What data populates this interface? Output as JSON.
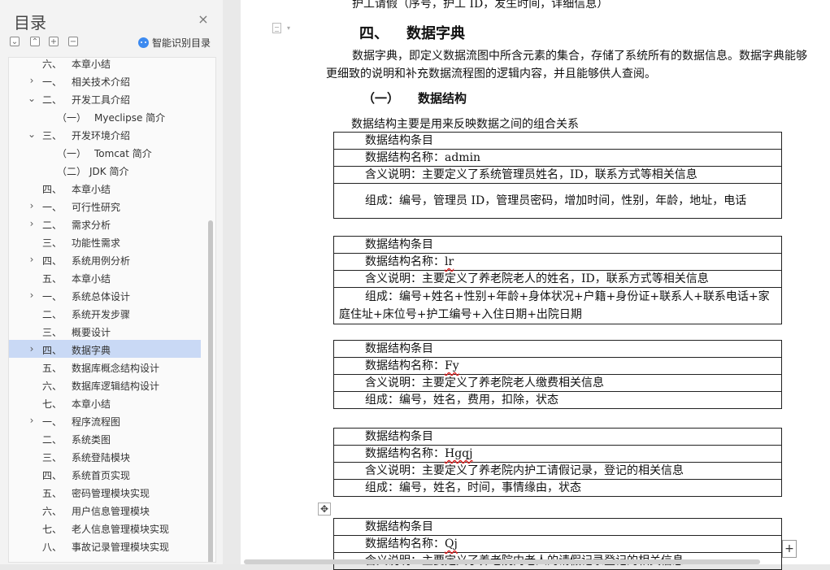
{
  "sidebar": {
    "title": "目录",
    "close": "×",
    "toolbar": {
      "collapse_all": "⌄",
      "expand_all": "⌃",
      "add": "+",
      "remove": "−",
      "ai_toc": "智能识别目录"
    },
    "items": [
      {
        "num": "六、",
        "label": "本章小结",
        "level": 1,
        "arrow": ""
      },
      {
        "num": "一、",
        "label": "相关技术介绍",
        "level": 1,
        "arrow": "›"
      },
      {
        "num": "二、",
        "label": "开发工具介绍",
        "level": 1,
        "arrow": "⌄"
      },
      {
        "num": "（一）",
        "label": "Myeclipse 简介",
        "level": 2,
        "arrow": ""
      },
      {
        "num": "三、",
        "label": "开发环境介绍",
        "level": 1,
        "arrow": "⌄"
      },
      {
        "num": "（一）",
        "label": "Tomcat 简介",
        "level": 2,
        "arrow": ""
      },
      {
        "num": "（二）",
        "label": "JDK 简介",
        "level": 2,
        "arrow": ""
      },
      {
        "num": "四、",
        "label": "本章小结",
        "level": 1,
        "arrow": ""
      },
      {
        "num": "一、",
        "label": "可行性研究",
        "level": 1,
        "arrow": "›"
      },
      {
        "num": "二、",
        "label": "需求分析",
        "level": 1,
        "arrow": "›"
      },
      {
        "num": "三、",
        "label": "功能性需求",
        "level": 1,
        "arrow": ""
      },
      {
        "num": "四、",
        "label": "系统用例分析",
        "level": 1,
        "arrow": "›"
      },
      {
        "num": "五、",
        "label": "本章小结",
        "level": 1,
        "arrow": ""
      },
      {
        "num": "一、",
        "label": "系统总体设计",
        "level": 1,
        "arrow": "›"
      },
      {
        "num": "二、",
        "label": "系统开发步骤",
        "level": 1,
        "arrow": ""
      },
      {
        "num": "三、",
        "label": "概要设计",
        "level": 1,
        "arrow": ""
      },
      {
        "num": "四、",
        "label": "数据字典",
        "level": 1,
        "arrow": "›",
        "selected": true
      },
      {
        "num": "五、",
        "label": "数据库概念结构设计",
        "level": 1,
        "arrow": ""
      },
      {
        "num": "六、",
        "label": "数据库逻辑结构设计",
        "level": 1,
        "arrow": ""
      },
      {
        "num": "七、",
        "label": "本章小结",
        "level": 1,
        "arrow": ""
      },
      {
        "num": "一、",
        "label": "程序流程图",
        "level": 1,
        "arrow": "›"
      },
      {
        "num": "二、",
        "label": "系统类图",
        "level": 1,
        "arrow": ""
      },
      {
        "num": "三、",
        "label": "系统登陆模块",
        "level": 1,
        "arrow": ""
      },
      {
        "num": "四、",
        "label": "系统首页实现",
        "level": 1,
        "arrow": ""
      },
      {
        "num": "五、",
        "label": "密码管理模块实现",
        "level": 1,
        "arrow": ""
      },
      {
        "num": "六、",
        "label": "用户信息管理模块",
        "level": 1,
        "arrow": ""
      },
      {
        "num": "七、",
        "label": "老人信息管理模块实现",
        "level": 1,
        "arrow": ""
      },
      {
        "num": "八、",
        "label": "事故记录管理模块实现",
        "level": 1,
        "arrow": ""
      }
    ]
  },
  "document": {
    "top_cut": "护工请假（序号，护工 ID，发生时间，详细信息）",
    "heading_num": "四、",
    "heading": "数据字典",
    "para1": "数据字典，即定义数据流图中所含元素的集合，存储了系统所有的数据信息。数据字典能够更细致的说明和补充数据流程图的逻辑内容，并且能够供人查阅。",
    "subheading_num": "（一）",
    "subheading": "数据结构",
    "para2": "数据结构主要是用来反映数据之间的组合关系",
    "tables": [
      {
        "entry": "数据结构条目",
        "name_label": "数据结构名称：",
        "name": "admin",
        "desc": "含义说明：主要定义了系统管理员姓名，ID，联系方式等相关信息",
        "comp": "组成：编号，管理员 ID，管理员密码，增加时间，性别，年龄，地址，电话"
      },
      {
        "entry": "数据结构条目",
        "name_label": "数据结构名称：",
        "name": "lr",
        "desc": "含义说明：主要定义了养老院老人的姓名，ID，联系方式等相关信息",
        "comp": "组成：编号+姓名+性别+年龄+身体状况+户籍+身份证+联系人+联系电话+家庭住址+床位号+护工编号+入住日期+出院日期"
      },
      {
        "entry": "数据结构条目",
        "name_label": "数据结构名称：",
        "name": "Fy",
        "desc": "含义说明：主要定义了养老院老人缴费相关信息",
        "comp": "组成：编号，姓名，费用，扣除，状态"
      },
      {
        "entry": "数据结构条目",
        "name_label": "数据结构名称：",
        "name": "Hgqj",
        "desc": "含义说明：主要定义了养老院内护工请假记录，登记的相关信息",
        "comp": "组成：编号，姓名，时间，事情缘由，状态"
      },
      {
        "entry": "数据结构条目",
        "name_label": "数据结构名称：",
        "name": "Qj",
        "desc": "含义说明：主要定义了养老院内老人的请假记录登记的相关信息",
        "comp": ""
      }
    ],
    "move_handle": "✥",
    "add_button": "+"
  }
}
